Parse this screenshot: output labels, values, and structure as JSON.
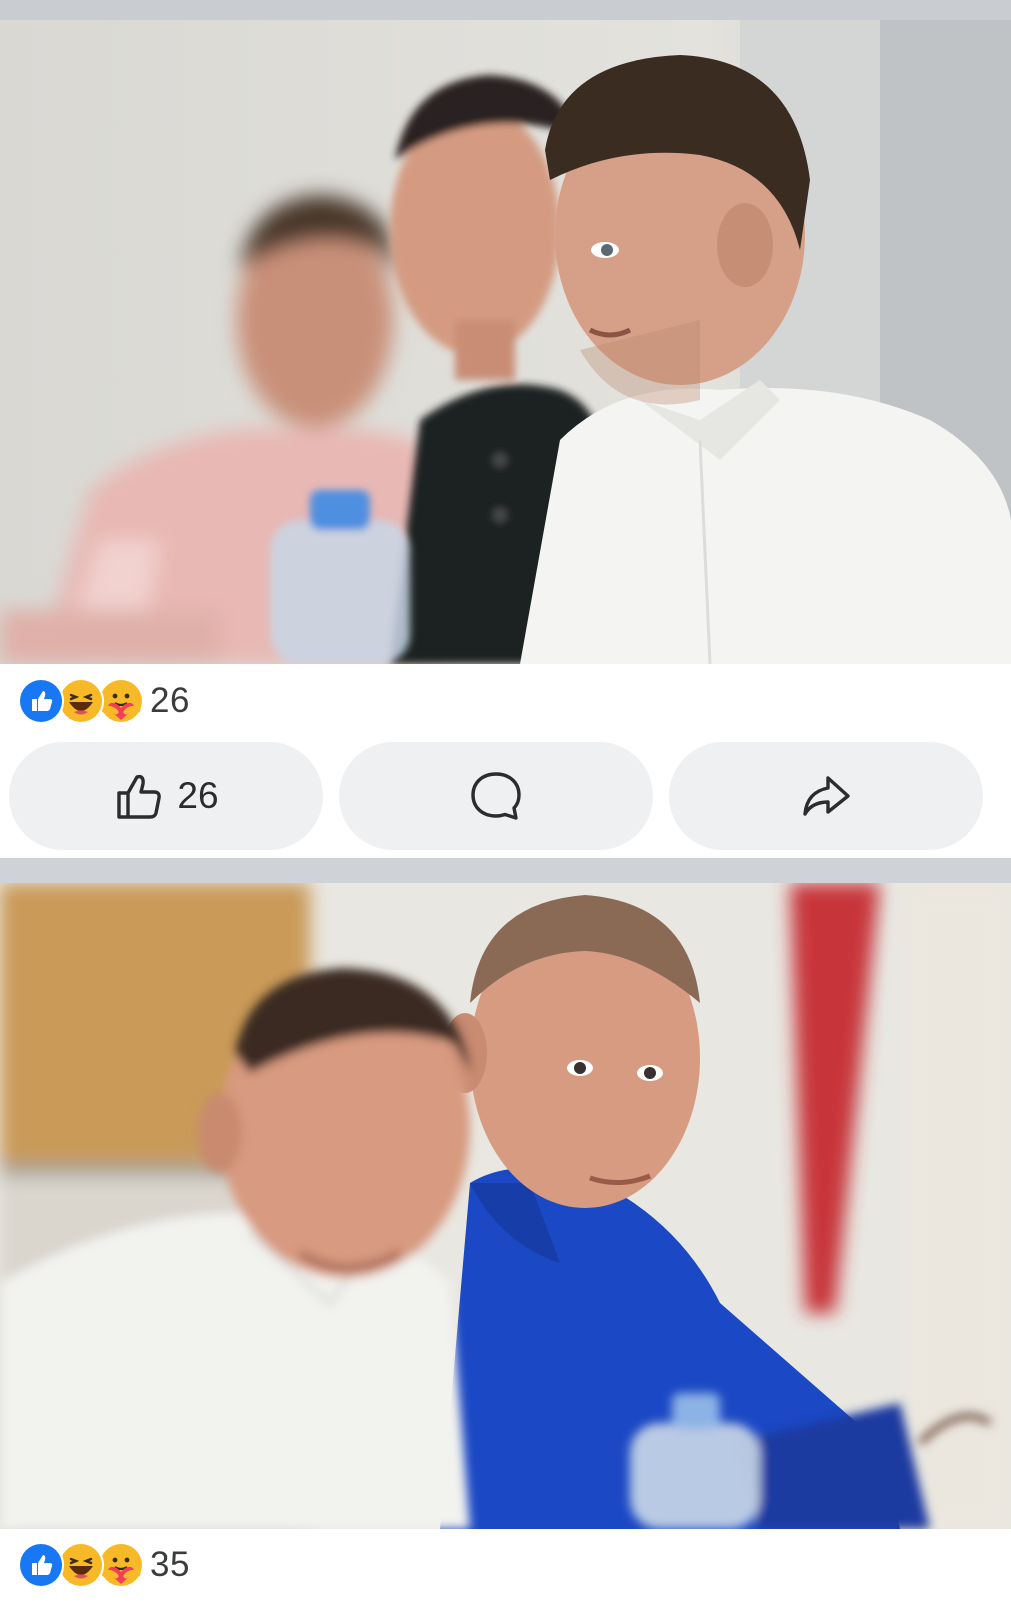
{
  "posts": [
    {
      "photo": {
        "description_icon": "photo-three-men-at-table"
      },
      "reactions": {
        "icons": [
          "like-icon",
          "haha-icon",
          "care-icon"
        ],
        "count": "26"
      },
      "actions": {
        "like_count": "26",
        "comment_icon": "comment-icon",
        "share_icon": "share-icon"
      }
    },
    {
      "photo": {
        "description_icon": "photo-two-men-at-table"
      },
      "reactions": {
        "icons": [
          "like-icon",
          "haha-icon",
          "care-icon"
        ],
        "count": "35"
      }
    }
  ],
  "colors": {
    "like_blue": "#1877f2",
    "feed_bg": "#cfd2d6",
    "button_bg": "#eff0f2",
    "text": "#3a3b3c"
  }
}
